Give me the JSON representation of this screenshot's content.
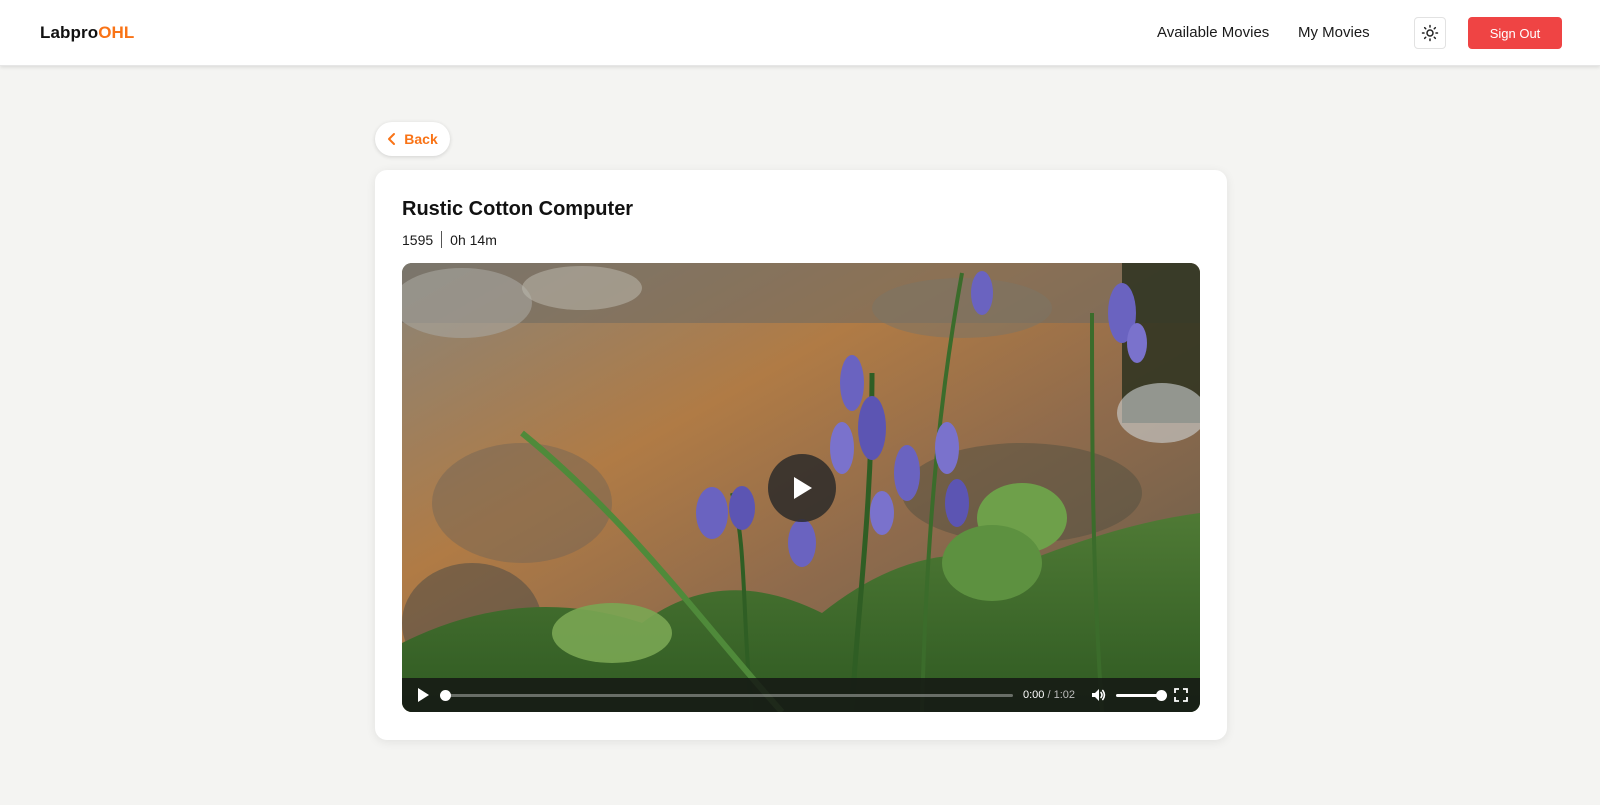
{
  "header": {
    "brand_prefix": "Labpro",
    "brand_accent": "OHL",
    "nav": {
      "available_label": "Available Movies",
      "mine_label": "My Movies"
    },
    "theme_icon": "sun-icon",
    "sign_out_label": "Sign Out"
  },
  "back": {
    "label": "Back",
    "icon": "chevron-left-icon"
  },
  "movie": {
    "title": "Rustic Cotton Computer",
    "year": "1595",
    "duration": "0h 14m"
  },
  "player": {
    "current_time": "0:00",
    "time_separator": " / ",
    "total_time": "1:02",
    "progress": 0,
    "volume": 1.0,
    "icons": {
      "big_play": "play-icon",
      "play": "play-icon",
      "volume": "volume-icon",
      "fullscreen": "fullscreen-icon"
    }
  },
  "colors": {
    "accent": "#f97316",
    "danger": "#ef4444",
    "background": "#f4f4f2"
  }
}
